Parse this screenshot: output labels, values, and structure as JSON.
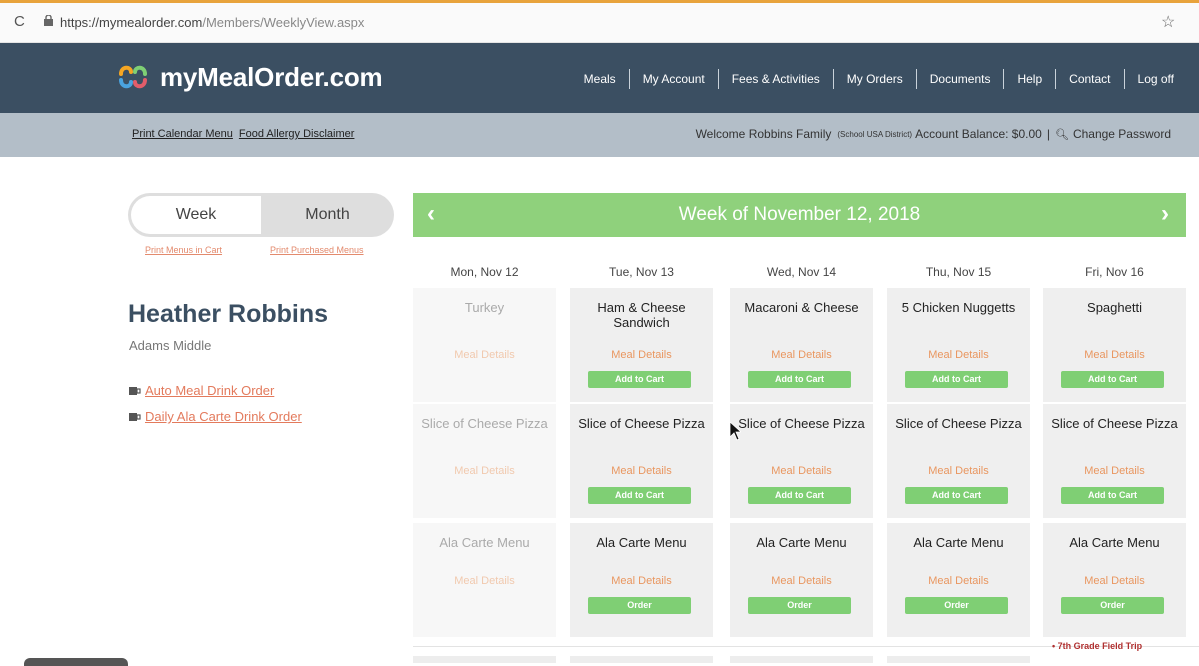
{
  "browser": {
    "url_host": "https://mymealorder.com",
    "url_path": "/Members/WeeklyView.aspx"
  },
  "header": {
    "logo_text": "myMealOrder.com",
    "nav": [
      "Meals",
      "My Account",
      "Fees & Activities",
      "My Orders",
      "Documents",
      "Help",
      "Contact",
      "Log off"
    ]
  },
  "subbar": {
    "print_calendar": "Print Calendar Menu",
    "allergy": "Food Allergy Disclaimer",
    "welcome": "Welcome Robbins Family",
    "district": "(School USA District)",
    "balance": "Account Balance: $0.00",
    "divider": "|",
    "change_password": "Change Password"
  },
  "view_toggle": {
    "week": "Week",
    "month": "Month",
    "print_cart": "Print Menus in Cart",
    "print_purchased": "Print Purchased Menus"
  },
  "student": {
    "name": "Heather Robbins",
    "school": "Adams Middle",
    "auto_drink": "Auto Meal Drink Order",
    "daily_drink": "Daily Ala Carte Drink Order"
  },
  "calendar": {
    "title": "Week of November 12, 2018",
    "prev": "‹",
    "next": "›",
    "days": [
      "Mon, Nov 12",
      "Tue, Nov 13",
      "Wed, Nov 14",
      "Thu, Nov 15",
      "Fri, Nov 16"
    ],
    "details_label": "Meal Details",
    "add_label": "Add to Cart",
    "order_label": "Order",
    "rows": [
      [
        "Turkey",
        "Ham & Cheese Sandwich",
        "Macaroni & Cheese",
        "5 Chicken Nuggetts",
        "Spaghetti"
      ],
      [
        "Slice of Cheese Pizza",
        "Slice of Cheese Pizza",
        "Slice of Cheese Pizza",
        "Slice of Cheese Pizza",
        "Slice of Cheese Pizza"
      ],
      [
        "Ala Carte Menu",
        "Ala Carte Menu",
        "Ala Carte Menu",
        "Ala Carte Menu",
        "Ala Carte Menu"
      ]
    ],
    "field_trip": "• 7th Grade Field Trip"
  },
  "colors": {
    "header": "#3b4f62",
    "subbar": "#b3bec8",
    "accent_green": "#8fd17c",
    "link_orange": "#e37a5c"
  }
}
